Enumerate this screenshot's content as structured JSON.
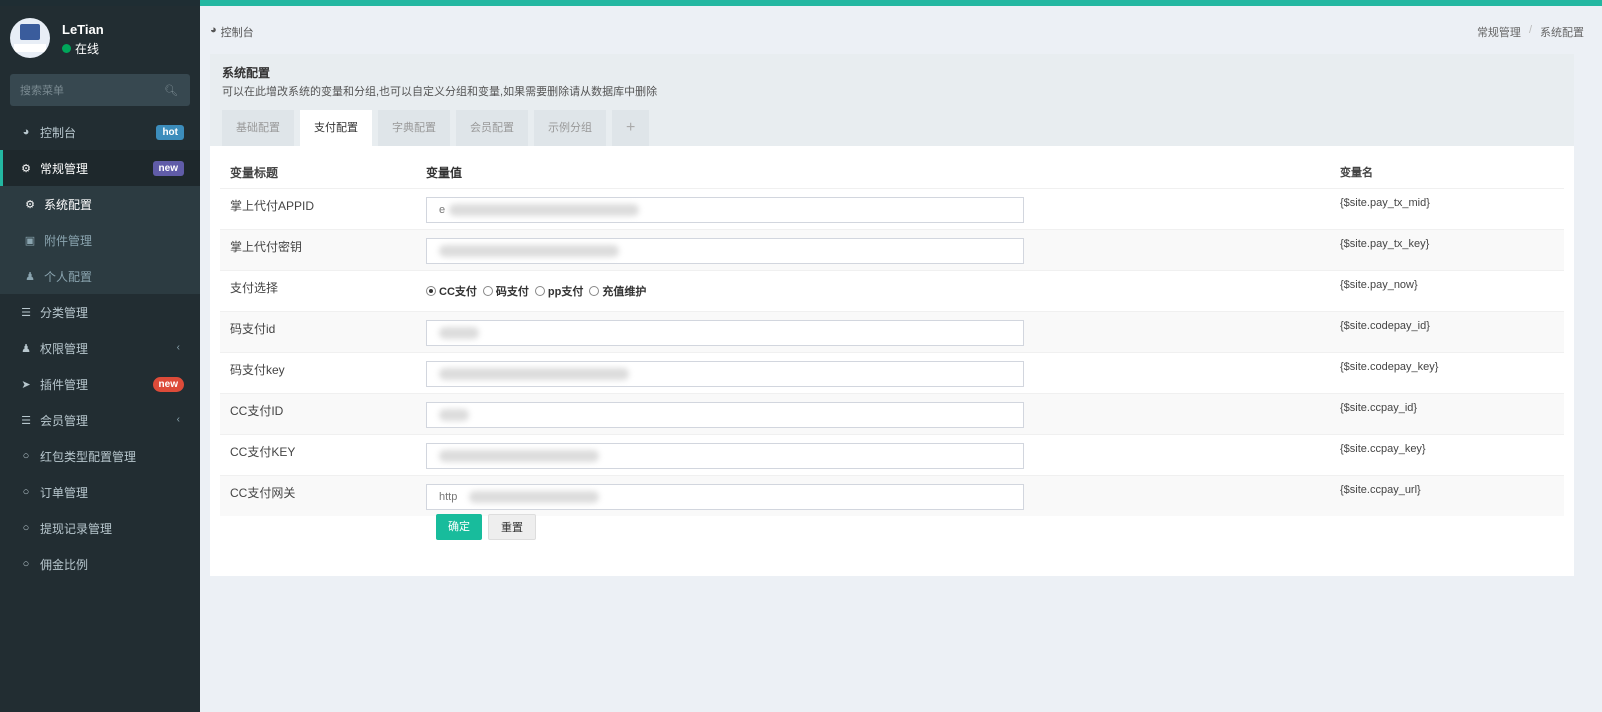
{
  "user": {
    "name": "LeTian",
    "status": "在线"
  },
  "search": {
    "placeholder": "搜索菜单"
  },
  "menu": [
    {
      "label": "控制台",
      "badge": "hot"
    },
    {
      "label": "常规管理",
      "badge": "new"
    },
    {
      "label": "系统配置"
    },
    {
      "label": "附件管理"
    },
    {
      "label": "个人配置"
    },
    {
      "label": "分类管理"
    },
    {
      "label": "权限管理"
    },
    {
      "label": "插件管理",
      "badge": "new"
    },
    {
      "label": "会员管理"
    },
    {
      "label": "红包类型配置管理"
    },
    {
      "label": "订单管理"
    },
    {
      "label": "提现记录管理"
    },
    {
      "label": "佣金比例"
    }
  ],
  "breadcrumb": {
    "home": "控制台",
    "parent": "常规管理",
    "current": "系统配置"
  },
  "panel": {
    "title": "系统配置",
    "desc": "可以在此增改系统的变量和分组,也可以自定义分组和变量,如果需要删除请从数据库中删除",
    "tabs": [
      "基础配置",
      "支付配置",
      "字典配置",
      "会员配置",
      "示例分组",
      "+"
    ]
  },
  "table": {
    "headers": [
      "变量标题",
      "变量值",
      "变量名"
    ],
    "rows": [
      {
        "title": "掌上代付APPID",
        "value": "e",
        "var": "{$site.pay_tx_mid}"
      },
      {
        "title": "掌上代付密钥",
        "value": "",
        "var": "{$site.pay_tx_key}"
      },
      {
        "title": "支付选择",
        "var": "{$site.pay_now}"
      },
      {
        "title": "码支付id",
        "value": "",
        "var": "{$site.codepay_id}"
      },
      {
        "title": "码支付key",
        "value": "",
        "var": "{$site.codepay_key}"
      },
      {
        "title": "CC支付ID",
        "value": "",
        "var": "{$site.ccpay_id}"
      },
      {
        "title": "CC支付KEY",
        "value": "",
        "var": "{$site.ccpay_key}"
      },
      {
        "title": "CC支付网关",
        "value": "http",
        "var": "{$site.ccpay_url}"
      }
    ],
    "radio_options": [
      "CC支付",
      "码支付",
      "pp支付",
      "充值维护"
    ],
    "radio_selected": "CC支付"
  },
  "buttons": {
    "ok": "确定",
    "reset": "重置"
  },
  "colors": {
    "accent": "#18bc9c",
    "sidebar": "#222d32",
    "hot": "#3c8dbc",
    "new": "#605ca8",
    "new_red": "#dd4b39"
  }
}
